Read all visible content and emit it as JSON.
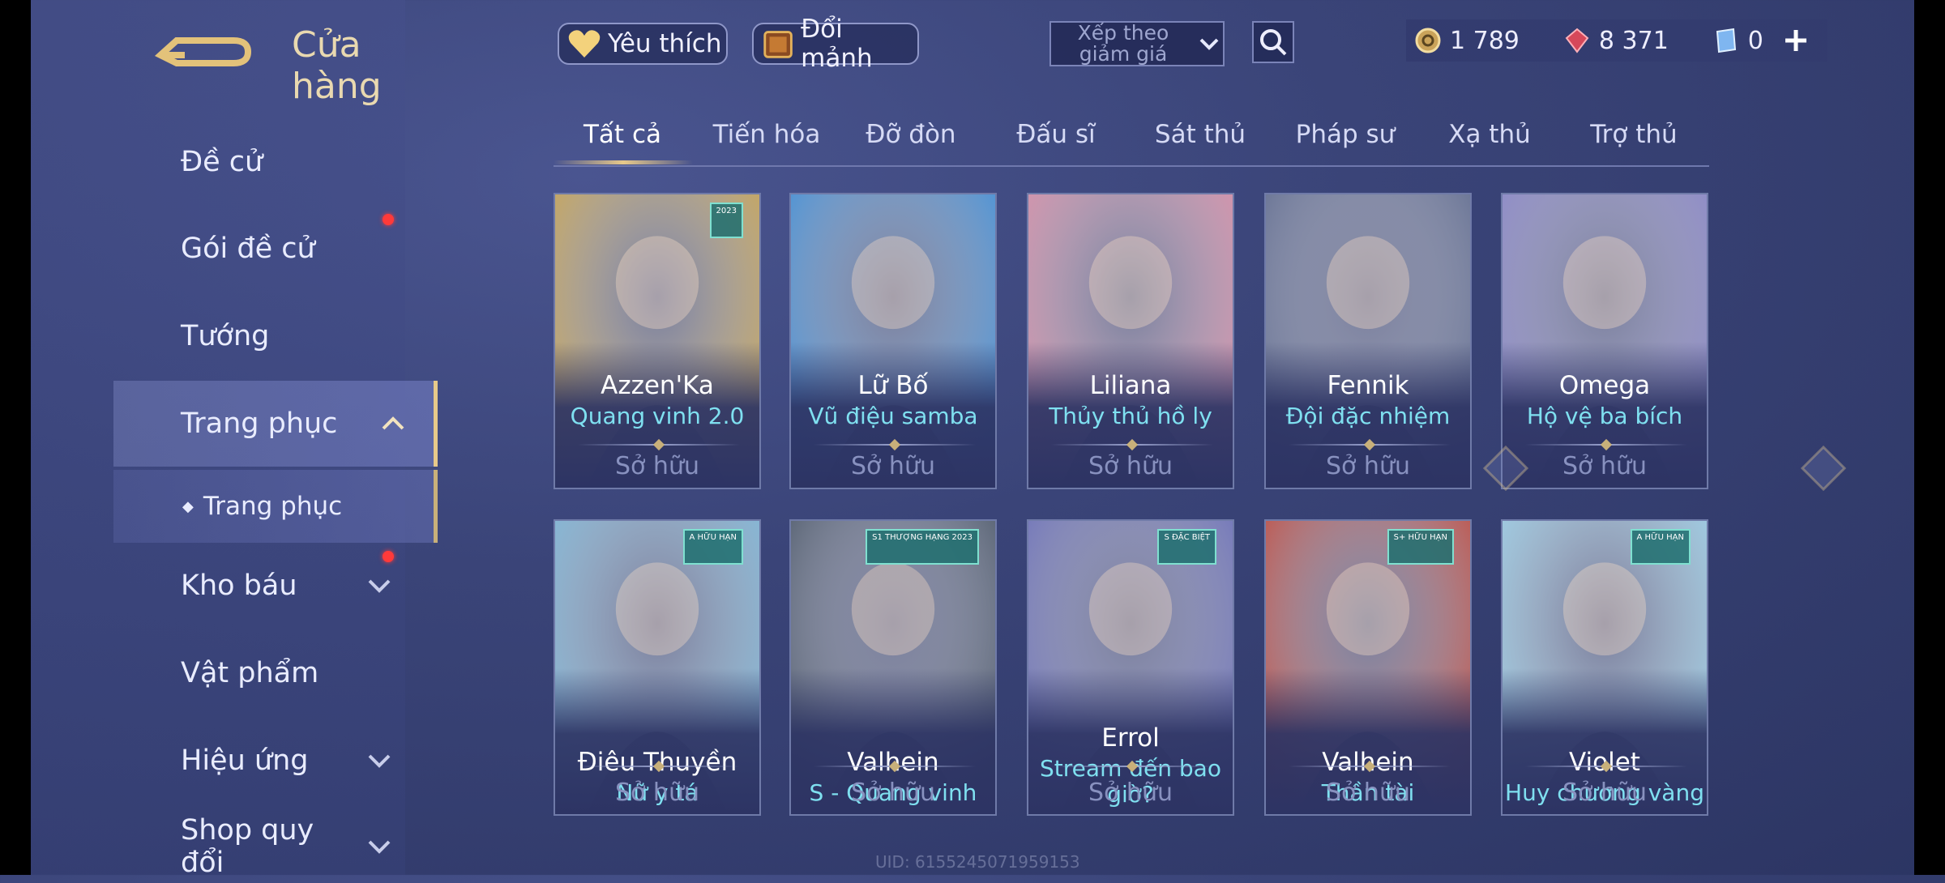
{
  "header": {
    "title": "Cửa hàng",
    "favorites_label": "Yêu thích",
    "exchange_label": "Đổi mảnh",
    "sort_label": "Xếp theo giảm giá"
  },
  "currencies": [
    {
      "name": "gold-coin",
      "value": "1 789"
    },
    {
      "name": "red-gem",
      "value": "8 371"
    },
    {
      "name": "voucher",
      "value": "0"
    }
  ],
  "sidebar": {
    "items": [
      {
        "label": "Đề cử"
      },
      {
        "label": "Gói đề cử"
      },
      {
        "label": "Tướng"
      },
      {
        "label": "Trang phục"
      },
      {
        "label": "Trang phục"
      },
      {
        "label": "Kho báu"
      },
      {
        "label": "Vật phẩm"
      },
      {
        "label": "Hiệu ứng"
      },
      {
        "label": "Shop quy đổi"
      }
    ]
  },
  "tabs": [
    {
      "label": "Tất cả"
    },
    {
      "label": "Tiến hóa"
    },
    {
      "label": "Đỡ đòn"
    },
    {
      "label": "Đấu sĩ"
    },
    {
      "label": "Sát thủ"
    },
    {
      "label": "Pháp sư"
    },
    {
      "label": "Xạ thủ"
    },
    {
      "label": "Trợ thủ"
    }
  ],
  "cards": [
    {
      "hero": "Azzen'Ka",
      "skin": "Quang vinh 2.0",
      "status": "Sở hữu",
      "badge": "2023",
      "color": "#c9a552"
    },
    {
      "hero": "Lữ Bố",
      "skin": "Vũ điệu samba",
      "status": "Sở hữu",
      "badge": "",
      "color": "#3f8fd8"
    },
    {
      "hero": "Liliana",
      "skin": "Thủy thủ hồ ly",
      "status": "Sở hữu",
      "badge": "",
      "color": "#d98fa8"
    },
    {
      "hero": "Fennik",
      "skin": "Đội đặc nhiệm",
      "status": "Sở hữu",
      "badge": "",
      "color": "#5f6b8e"
    },
    {
      "hero": "Omega",
      "skin": "Hộ vệ ba bích",
      "status": "Sở hữu",
      "badge": "",
      "color": "#8a86c8"
    },
    {
      "hero": "Điêu Thuyền",
      "skin": "Nữ y tá",
      "status": "Sở hữu",
      "badge": "A HỮU HẠN",
      "color": "#7fb8d8"
    },
    {
      "hero": "Valhein",
      "skin": "S - Quang vinh",
      "status": "Sở hữu",
      "badge": "S1 THƯỢNG HẠNG 2023",
      "color": "#4c5868"
    },
    {
      "hero": "Errol",
      "skin": "Stream đến bao giờ?",
      "status": "Sở hữu",
      "badge": "S ĐẶC BIỆT",
      "color": "#6b6fb8"
    },
    {
      "hero": "Valhein",
      "skin": "Thần tài",
      "status": "Sở hữu",
      "badge": "S+ HỮU HẠN",
      "color": "#c04a3e"
    },
    {
      "hero": "Violet",
      "skin": "Huy chương vàng",
      "status": "Sở hữu",
      "badge": "A HỮU HẠN",
      "color": "#9ccfe6"
    }
  ],
  "footer": {
    "uid": "UID: 6155245071959153"
  }
}
